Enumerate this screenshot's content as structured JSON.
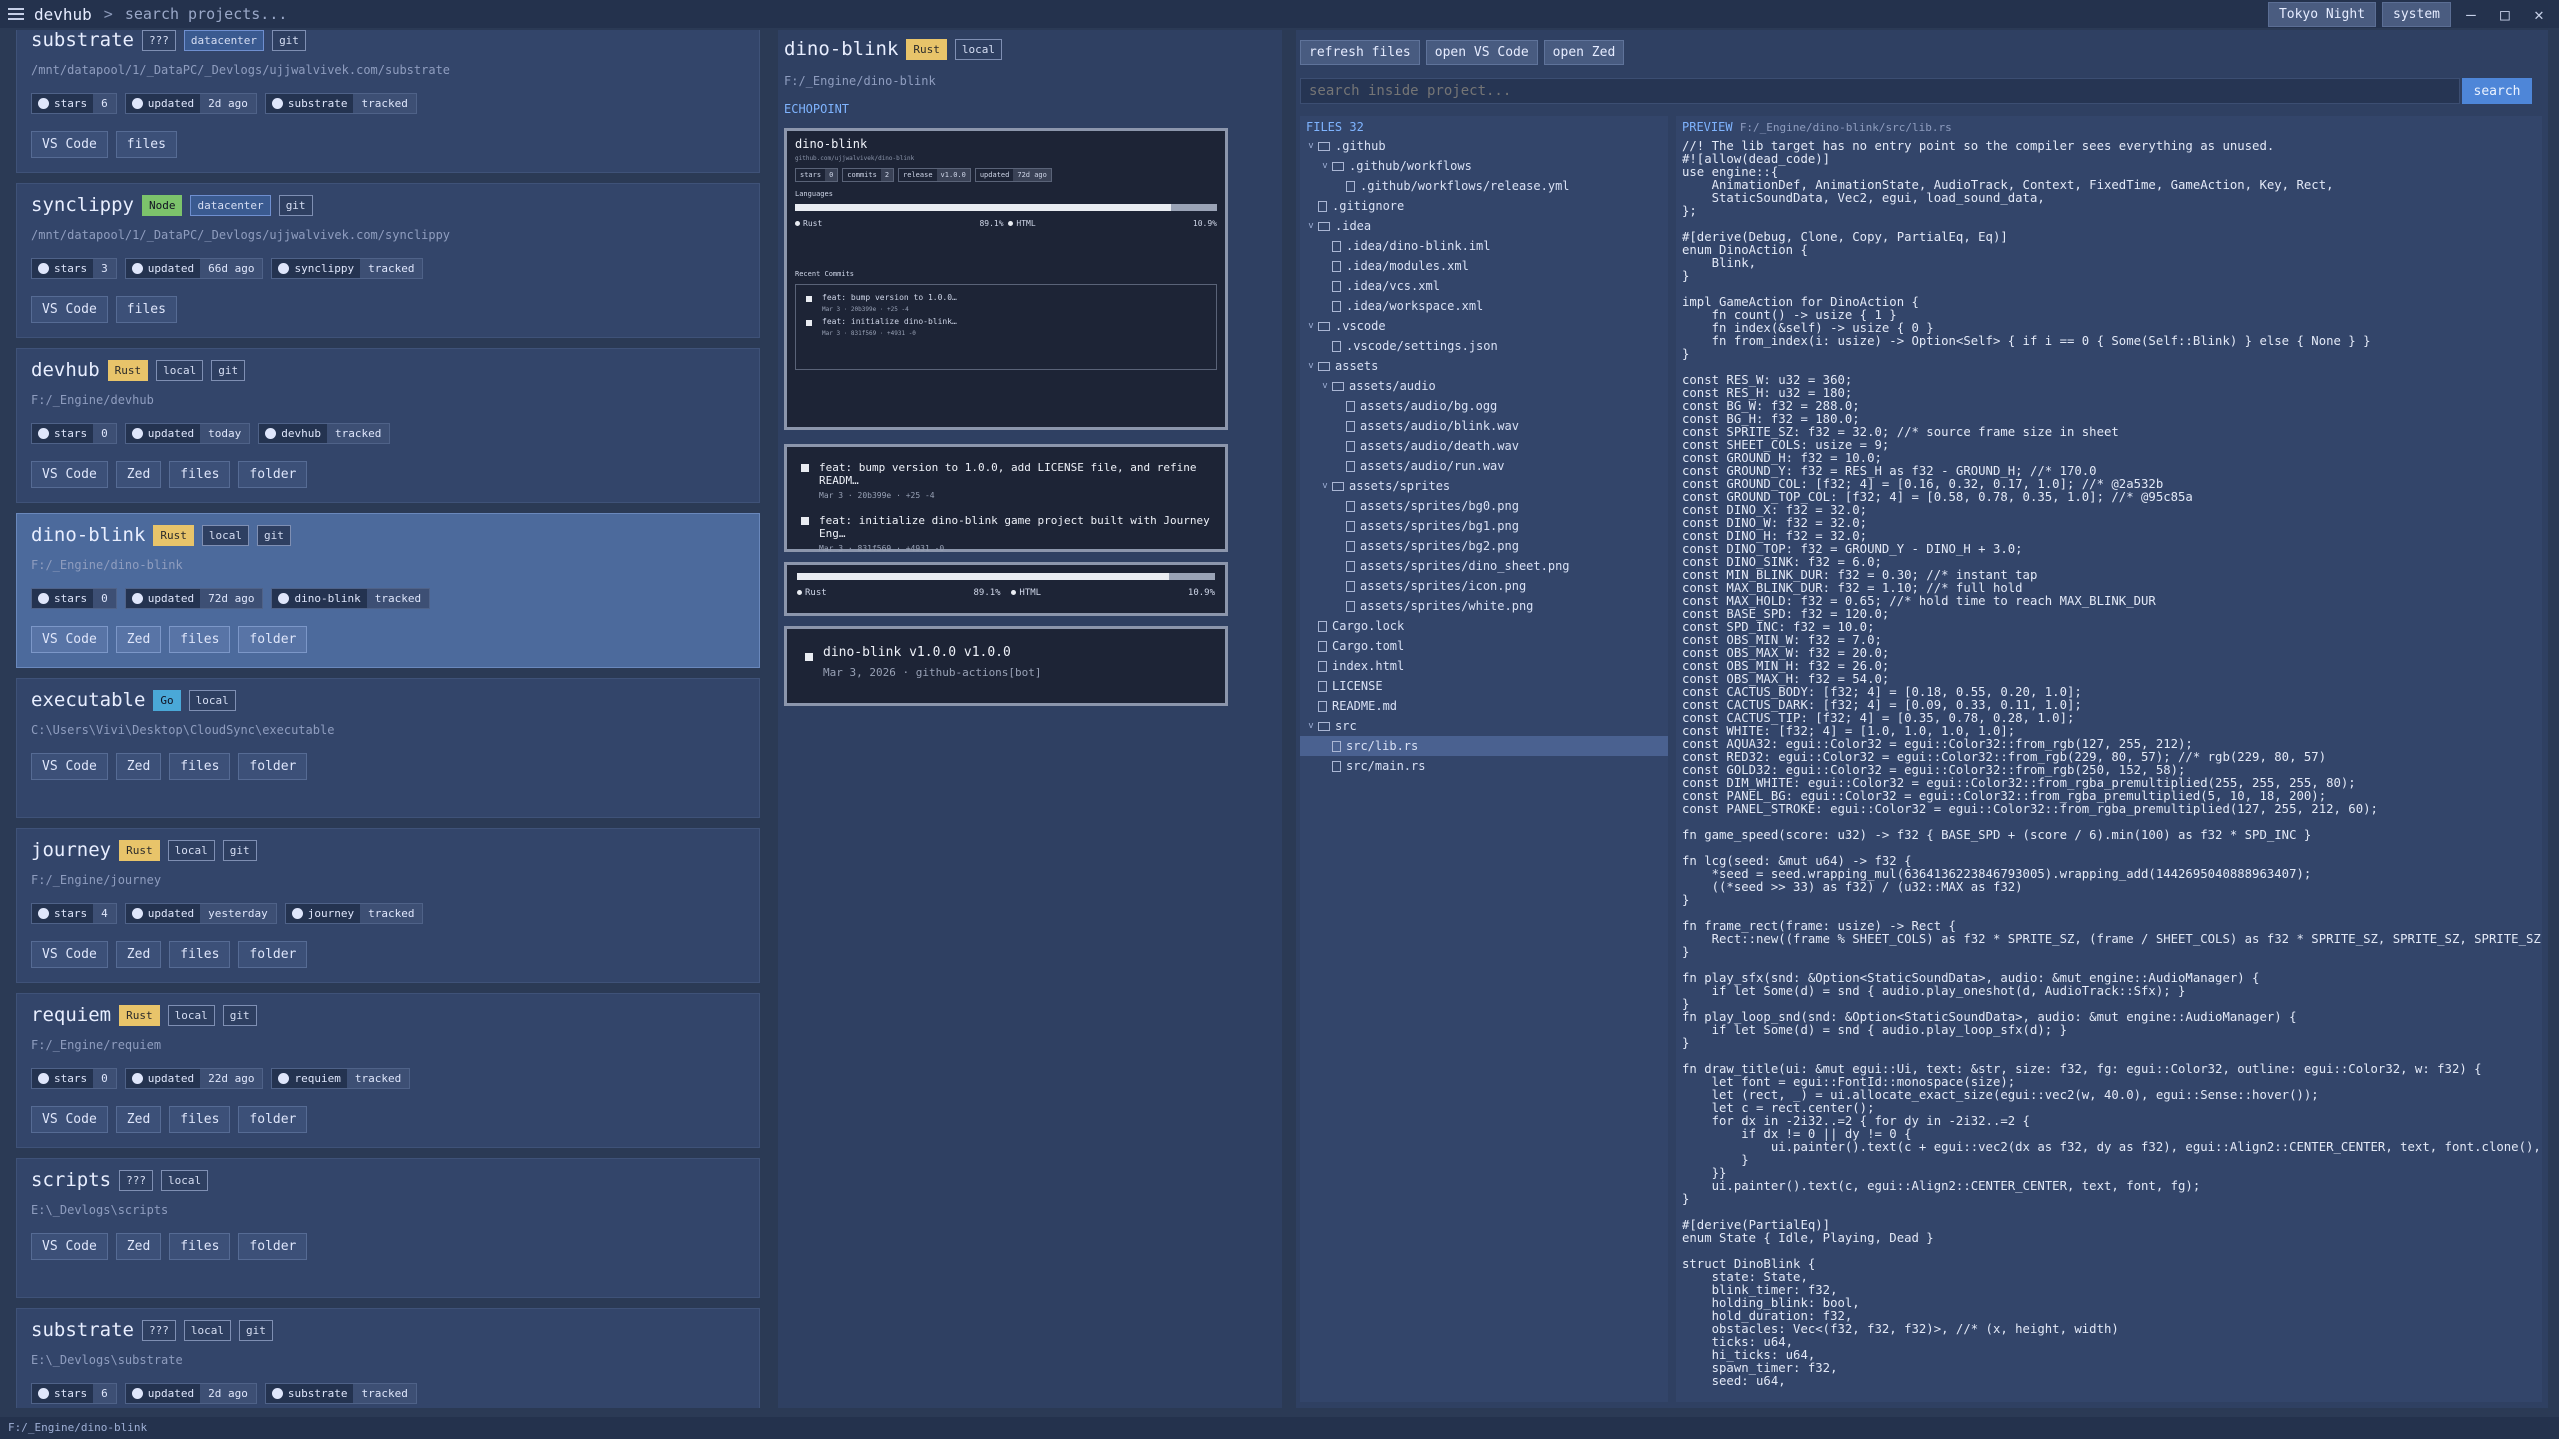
{
  "app": {
    "name": "devhub",
    "search_placeholder": "search projects...",
    "theme": "Tokyo Night",
    "mode": "system",
    "controls": [
      "–",
      "□",
      "✕"
    ]
  },
  "projects": [
    {
      "name": "substrate",
      "badges": [
        "???",
        "datacenter",
        "git"
      ],
      "path": "/mnt/datapool/1/_DataPC/_Devlogs/ujjwalvivek.com/substrate",
      "stars": "6",
      "updated": "2d ago",
      "repo": "substrate",
      "tracked": "tracked",
      "actions": [
        "VS Code",
        "files"
      ]
    },
    {
      "name": "synclippy",
      "badges": [
        "Node",
        "datacenter",
        "git"
      ],
      "path": "/mnt/datapool/1/_DataPC/_Devlogs/ujjwalvivek.com/synclippy",
      "stars": "3",
      "updated": "66d ago",
      "repo": "synclippy",
      "tracked": "tracked",
      "actions": [
        "VS Code",
        "files"
      ]
    },
    {
      "name": "devhub",
      "badges": [
        "Rust",
        "local",
        "git"
      ],
      "path": "F:/_Engine/devhub",
      "stars": "0",
      "updated": "today",
      "repo": "devhub",
      "tracked": "tracked",
      "actions": [
        "VS Code",
        "Zed",
        "files",
        "folder"
      ]
    },
    {
      "name": "dino-blink",
      "badges": [
        "Rust",
        "local",
        "git"
      ],
      "path": "F:/_Engine/dino-blink",
      "stars": "0",
      "updated": "72d ago",
      "repo": "dino-blink",
      "tracked": "tracked",
      "actions": [
        "VS Code",
        "Zed",
        "files",
        "folder"
      ]
    },
    {
      "name": "executable",
      "badges": [
        "Go",
        "local"
      ],
      "path": "C:\\Users\\Vivi\\Desktop\\CloudSync\\executable",
      "actions": [
        "VS Code",
        "Zed",
        "files",
        "folder"
      ]
    },
    {
      "name": "journey",
      "badges": [
        "Rust",
        "local",
        "git"
      ],
      "path": "F:/_Engine/journey",
      "stars": "4",
      "updated": "yesterday",
      "repo": "journey",
      "tracked": "tracked",
      "actions": [
        "VS Code",
        "Zed",
        "files",
        "folder"
      ]
    },
    {
      "name": "requiem",
      "badges": [
        "Rust",
        "local",
        "git"
      ],
      "path": "F:/_Engine/requiem",
      "stars": "0",
      "updated": "22d ago",
      "repo": "requiem",
      "tracked": "tracked",
      "actions": [
        "VS Code",
        "Zed",
        "files",
        "folder"
      ]
    },
    {
      "name": "scripts",
      "badges": [
        "???",
        "local"
      ],
      "path": "E:\\_Devlogs\\scripts",
      "actions": [
        "VS Code",
        "Zed",
        "files",
        "folder"
      ]
    },
    {
      "name": "substrate",
      "badges": [
        "???",
        "local",
        "git"
      ],
      "path": "E:\\_Devlogs\\substrate",
      "stars": "6",
      "updated": "2d ago",
      "repo": "substrate",
      "tracked": "tracked",
      "actions": [
        "VS Code",
        "Zed",
        "files",
        "folder"
      ]
    }
  ],
  "labels": {
    "stars": "stars",
    "updated": "updated"
  },
  "detail": {
    "name": "dino-blink",
    "badges": [
      "Rust",
      "local"
    ],
    "path": "F:/_Engine/dino-blink",
    "section": "ECHOPOINT",
    "mini": {
      "title": "dino-blink",
      "url": "github.com/ujjwalvivek/dino-blink",
      "stars_k": "stars",
      "stars_v": "0",
      "commits_k": "commits",
      "commits_v": "2",
      "release_k": "release",
      "release_v": "v1.0.0",
      "updated_k": "updated",
      "updated_v": "72d ago",
      "languages": "Languages",
      "recent": "Recent Commits",
      "c1": "feat: bump version to 1.0.0…",
      "c1m": "Mar 3 · 20b399e · +25 -4",
      "c2": "feat: initialize dino-blink…",
      "c2m": "Mar 3 · 831f569 · +4931 -0"
    },
    "commits": [
      {
        "msg": "feat: bump version to 1.0.0, add LICENSE file, and refine READM…",
        "meta": "Mar 3 · 20b399e · +25 -4"
      },
      {
        "msg": "feat: initialize dino-blink game project built with Journey Eng…",
        "meta": "Mar 3 · 831f569 · +4931 -0"
      }
    ],
    "languages": [
      {
        "name": "Rust",
        "pct": "89.1%"
      },
      {
        "name": "HTML",
        "pct": "10.9%"
      }
    ],
    "release": {
      "title": "dino-blink v1.0.0 v1.0.0",
      "meta": "Mar 3, 2026 · github-actions[bot]"
    }
  },
  "files_panel": {
    "buttons": [
      "refresh files",
      "open VS Code",
      "open Zed"
    ],
    "search_placeholder": "search inside project...",
    "search_label": "search",
    "header": "FILES 32",
    "tree": [
      {
        "t": "d",
        "l": 0,
        "n": ".github"
      },
      {
        "t": "d",
        "l": 1,
        "n": ".github/workflows"
      },
      {
        "t": "f",
        "l": 2,
        "n": ".github/workflows/release.yml"
      },
      {
        "t": "f",
        "l": 0,
        "n": ".gitignore"
      },
      {
        "t": "d",
        "l": 0,
        "n": ".idea"
      },
      {
        "t": "f",
        "l": 1,
        "n": ".idea/dino-blink.iml"
      },
      {
        "t": "f",
        "l": 1,
        "n": ".idea/modules.xml"
      },
      {
        "t": "f",
        "l": 1,
        "n": ".idea/vcs.xml"
      },
      {
        "t": "f",
        "l": 1,
        "n": ".idea/workspace.xml"
      },
      {
        "t": "d",
        "l": 0,
        "n": ".vscode"
      },
      {
        "t": "f",
        "l": 1,
        "n": ".vscode/settings.json"
      },
      {
        "t": "d",
        "l": 0,
        "n": "assets"
      },
      {
        "t": "d",
        "l": 1,
        "n": "assets/audio"
      },
      {
        "t": "f",
        "l": 2,
        "n": "assets/audio/bg.ogg"
      },
      {
        "t": "f",
        "l": 2,
        "n": "assets/audio/blink.wav"
      },
      {
        "t": "f",
        "l": 2,
        "n": "assets/audio/death.wav"
      },
      {
        "t": "f",
        "l": 2,
        "n": "assets/audio/run.wav"
      },
      {
        "t": "d",
        "l": 1,
        "n": "assets/sprites"
      },
      {
        "t": "f",
        "l": 2,
        "n": "assets/sprites/bg0.png"
      },
      {
        "t": "f",
        "l": 2,
        "n": "assets/sprites/bg1.png"
      },
      {
        "t": "f",
        "l": 2,
        "n": "assets/sprites/bg2.png"
      },
      {
        "t": "f",
        "l": 2,
        "n": "assets/sprites/dino_sheet.png"
      },
      {
        "t": "f",
        "l": 2,
        "n": "assets/sprites/icon.png"
      },
      {
        "t": "f",
        "l": 2,
        "n": "assets/sprites/white.png"
      },
      {
        "t": "f",
        "l": 0,
        "n": "Cargo.lock"
      },
      {
        "t": "f",
        "l": 0,
        "n": "Cargo.toml"
      },
      {
        "t": "f",
        "l": 0,
        "n": "index.html"
      },
      {
        "t": "f",
        "l": 0,
        "n": "LICENSE"
      },
      {
        "t": "f",
        "l": 0,
        "n": "README.md"
      },
      {
        "t": "d",
        "l": 0,
        "n": "src"
      },
      {
        "t": "f",
        "l": 1,
        "n": "src/lib.rs",
        "sel": true
      },
      {
        "t": "f",
        "l": 1,
        "n": "src/main.rs"
      }
    ],
    "preview_label": "PREVIEW",
    "preview_path": "F:/_Engine/dino-blink/src/lib.rs",
    "code": "//! The lib target has no entry point so the compiler sees everything as unused.\n#![allow(dead_code)]\nuse engine::{\n    AnimationDef, AnimationState, AudioTrack, Context, FixedTime, GameAction, Key, Rect,\n    StaticSoundData, Vec2, egui, load_sound_data,\n};\n\n#[derive(Debug, Clone, Copy, PartialEq, Eq)]\nenum DinoAction {\n    Blink,\n}\n\nimpl GameAction for DinoAction {\n    fn count() -> usize { 1 }\n    fn index(&self) -> usize { 0 }\n    fn from_index(i: usize) -> Option<Self> { if i == 0 { Some(Self::Blink) } else { None } }\n}\n\nconst RES_W: u32 = 360;\nconst RES_H: u32 = 180;\nconst BG_W: f32 = 288.0;\nconst BG_H: f32 = 180.0;\nconst SPRITE_SZ: f32 = 32.0; //* source frame size in sheet\nconst SHEET_COLS: usize = 9;\nconst GROUND_H: f32 = 10.0;\nconst GROUND_Y: f32 = RES_H as f32 - GROUND_H; //* 170.0\nconst GROUND_COL: [f32; 4] = [0.16, 0.32, 0.17, 1.0]; //* @2a532b\nconst GROUND_TOP_COL: [f32; 4] = [0.58, 0.78, 0.35, 1.0]; //* @95c85a\nconst DINO_X: f32 = 32.0;\nconst DINO_W: f32 = 32.0;\nconst DINO_H: f32 = 32.0;\nconst DINO_TOP: f32 = GROUND_Y - DINO_H + 3.0;\nconst DINO_SINK: f32 = 6.0;\nconst MIN_BLINK_DUR: f32 = 0.30; //* instant tap\nconst MAX_BLINK_DUR: f32 = 1.10; //* full hold\nconst MAX_HOLD: f32 = 0.65; //* hold time to reach MAX_BLINK_DUR\nconst BASE_SPD: f32 = 120.0;\nconst SPD_INC: f32 = 10.0;\nconst OBS_MIN_W: f32 = 7.0;\nconst OBS_MAX_W: f32 = 20.0;\nconst OBS_MIN_H: f32 = 26.0;\nconst OBS_MAX_H: f32 = 54.0;\nconst CACTUS_BODY: [f32; 4] = [0.18, 0.55, 0.20, 1.0];\nconst CACTUS_DARK: [f32; 4] = [0.09, 0.33, 0.11, 1.0];\nconst CACTUS_TIP: [f32; 4] = [0.35, 0.78, 0.28, 1.0];\nconst WHITE: [f32; 4] = [1.0, 1.0, 1.0, 1.0];\nconst AQUA32: egui::Color32 = egui::Color32::from_rgb(127, 255, 212);\nconst RED32: egui::Color32 = egui::Color32::from_rgb(229, 80, 57); //* rgb(229, 80, 57)\nconst GOLD32: egui::Color32 = egui::Color32::from_rgb(250, 152, 58);\nconst DIM_WHITE: egui::Color32 = egui::Color32::from_rgba_premultiplied(255, 255, 255, 80);\nconst PANEL_BG: egui::Color32 = egui::Color32::from_rgba_premultiplied(5, 10, 18, 200);\nconst PANEL_STROKE: egui::Color32 = egui::Color32::from_rgba_premultiplied(127, 255, 212, 60);\n\nfn game_speed(score: u32) -> f32 { BASE_SPD + (score / 6).min(100) as f32 * SPD_INC }\n\nfn lcg(seed: &mut u64) -> f32 {\n    *seed = seed.wrapping_mul(6364136223846793005).wrapping_add(1442695040888963407);\n    ((*seed >> 33) as f32) / (u32::MAX as f32)\n}\n\nfn frame_rect(frame: usize) -> Rect {\n    Rect::new((frame % SHEET_COLS) as f32 * SPRITE_SZ, (frame / SHEET_COLS) as f32 * SPRITE_SZ, SPRITE_SZ, SPRITE_SZ)\n}\n\nfn play_sfx(snd: &Option<StaticSoundData>, audio: &mut engine::AudioManager) {\n    if let Some(d) = snd { audio.play_oneshot(d, AudioTrack::Sfx); }\n}\nfn play_loop_snd(snd: &Option<StaticSoundData>, audio: &mut engine::AudioManager) {\n    if let Some(d) = snd { audio.play_loop_sfx(d); }\n}\n\nfn draw_title(ui: &mut egui::Ui, text: &str, size: f32, fg: egui::Color32, outline: egui::Color32, w: f32) {\n    let font = egui::FontId::monospace(size);\n    let (rect, _) = ui.allocate_exact_size(egui::vec2(w, 40.0), egui::Sense::hover());\n    let c = rect.center();\n    for dx in -2i32..=2 { for dy in -2i32..=2 {\n        if dx != 0 || dy != 0 {\n            ui.painter().text(c + egui::vec2(dx as f32, dy as f32), egui::Align2::CENTER_CENTER, text, font.clone(), outlin\n        }\n    }}\n    ui.painter().text(c, egui::Align2::CENTER_CENTER, text, font, fg);\n}\n\n#[derive(PartialEq)]\nenum State { Idle, Playing, Dead }\n\nstruct DinoBlink {\n    state: State,\n    blink_timer: f32,\n    holding_blink: bool,\n    hold_duration: f32,\n    obstacles: Vec<(f32, f32, f32)>, //* (x, height, width)\n    ticks: u64,\n    hi_ticks: u64,\n    spawn_timer: f32,\n    seed: u64,"
  },
  "status": {
    "path": "F:/_Engine/dino-blink"
  }
}
